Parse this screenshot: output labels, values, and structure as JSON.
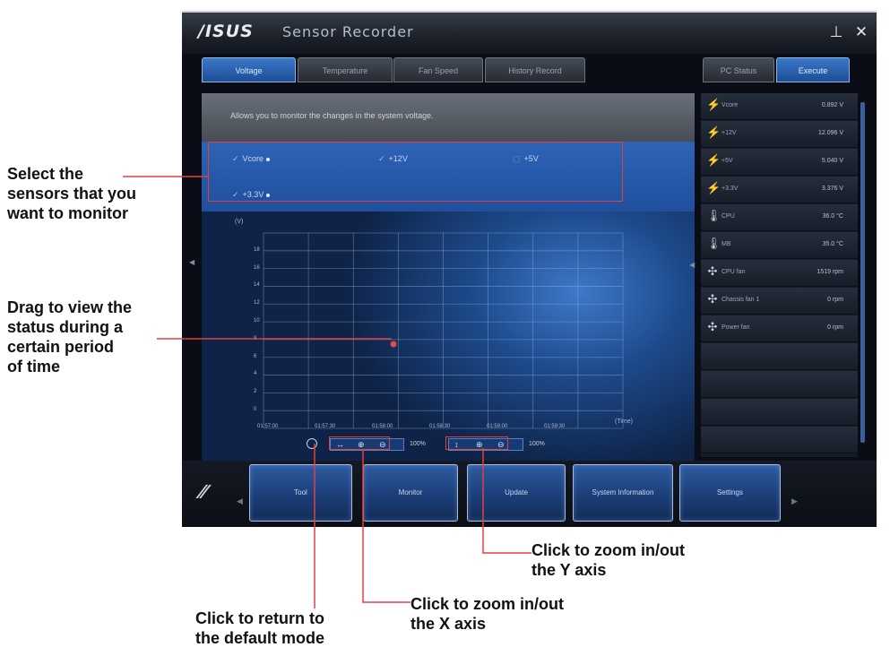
{
  "window": {
    "logo": "/ISUS",
    "title": "Sensor Recorder",
    "minimize_glyph": "⊥",
    "close_glyph": "✕"
  },
  "tabs": [
    {
      "label": "Voltage",
      "active": true
    },
    {
      "label": "Temperature",
      "active": false
    },
    {
      "label": "Fan Speed",
      "active": false
    },
    {
      "label": "History Record",
      "active": false
    }
  ],
  "side_tabs": [
    {
      "label": "PC Status",
      "active": false
    },
    {
      "label": "Execute",
      "active": true
    }
  ],
  "description": "Allows you to monitor the changes in the system voltage.",
  "sensor_checkboxes": [
    {
      "label": "Vcore",
      "checked": true
    },
    {
      "label": "+12V",
      "checked": true
    },
    {
      "label": "+5V",
      "checked": false
    },
    {
      "label": "+3.3V",
      "checked": true
    }
  ],
  "chart": {
    "unit_label": "(V)",
    "time_label": "(Time)",
    "y_ticks": [
      "",
      "18",
      "16",
      "14",
      "12",
      "10",
      "8",
      "6",
      "4",
      "2",
      "0"
    ],
    "x_ticks": [
      "01:57:00",
      "01:57:30",
      "01:58:00",
      "01:58:30",
      "01:59:00",
      "01:59:30"
    ],
    "zoom_x_value": "100%",
    "zoom_y_value": "100%"
  },
  "sensors_panel": [
    {
      "name": "Vcore",
      "value": "0.892 V",
      "icon": "lightning-icon"
    },
    {
      "name": "+12V",
      "value": "12.096 V",
      "icon": "lightning-icon"
    },
    {
      "name": "+5V",
      "value": "5.040 V",
      "icon": "lightning-icon"
    },
    {
      "name": "+3.3V",
      "value": "3.376 V",
      "icon": "lightning-icon"
    },
    {
      "name": "CPU",
      "value": "36.0 °C",
      "icon": "thermometer-icon"
    },
    {
      "name": "MB",
      "value": "35.0 °C",
      "icon": "thermometer-icon"
    },
    {
      "name": "CPU fan",
      "value": "1519 rpm",
      "icon": "fan-icon"
    },
    {
      "name": "Chassis fan 1",
      "value": "0 rpm",
      "icon": "fan-icon"
    },
    {
      "name": "Power fan",
      "value": "0 rpm",
      "icon": "fan-icon"
    }
  ],
  "bottom_nav": [
    {
      "label": "Tool"
    },
    {
      "label": "Monitor"
    },
    {
      "label": "Update"
    },
    {
      "label": "System Information"
    },
    {
      "label": "Settings"
    }
  ],
  "callouts": {
    "select_sensors": [
      "Select the",
      "sensors that you",
      "want to monitor"
    ],
    "drag_view": [
      "Drag to view the",
      "status during a",
      "certain period",
      "of time"
    ],
    "zoom_y": [
      "Click to zoom in/out",
      "the Y axis"
    ],
    "zoom_x": [
      "Click to zoom in/out",
      "the X axis"
    ],
    "return_default": [
      "Click to return to",
      "the default mode"
    ]
  },
  "colors": {
    "accent": "#2f63b5",
    "callout_line": "#e04040",
    "callout_text": "#111111"
  }
}
